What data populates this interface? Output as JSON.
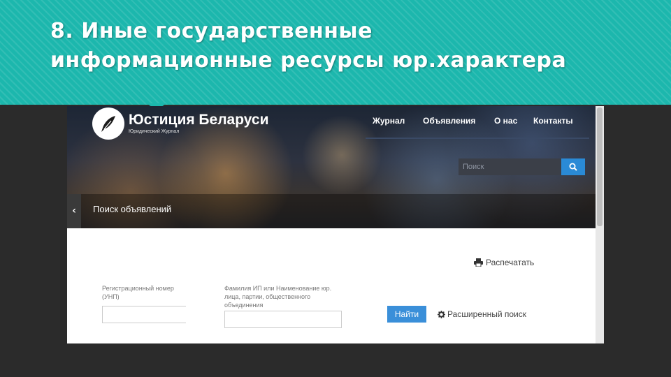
{
  "slide": {
    "title": "8. Иные государственные\nинформационные ресурсы юр.характера"
  },
  "site": {
    "logo_title": "Юстиция Беларуси",
    "logo_subtitle": "Юридический Журнал",
    "nav": [
      {
        "label": "Журнал"
      },
      {
        "label": "Объявления"
      },
      {
        "label": "О нас"
      },
      {
        "label": "Контакты"
      }
    ],
    "search": {
      "placeholder": "Поиск"
    },
    "section_title": "Поиск объявлений",
    "back_icon": "‹"
  },
  "form": {
    "print_label": "Распечатать",
    "field1_label": "Регистрационный номер\n(УНП)",
    "field2_label": "Фамилия ИП или Наименование юр.\nлица, партии, общественного\nобъединения",
    "find_label": "Найти",
    "advanced_label": "Расширенный поиск"
  },
  "colors": {
    "header_teal": "#1cb7ad",
    "accent_blue": "#3a8fd9"
  }
}
